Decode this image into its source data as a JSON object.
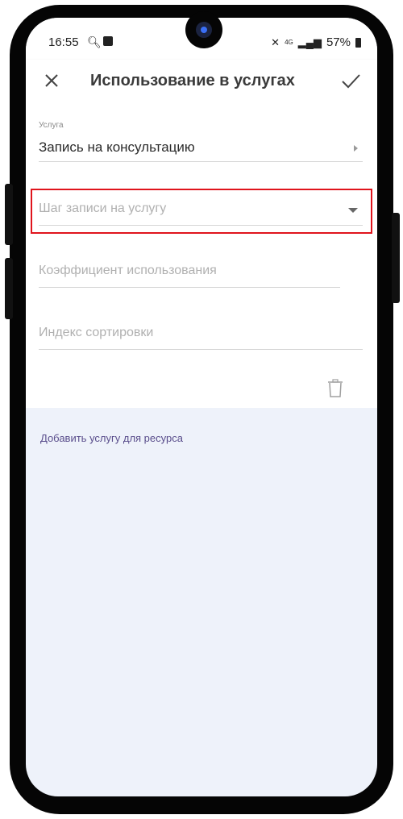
{
  "status_bar": {
    "time": "16:55",
    "battery": "57%",
    "network": "4G"
  },
  "header": {
    "title": "Использование в услугах",
    "close_icon": "close-icon",
    "confirm_icon": "check-icon"
  },
  "form": {
    "service": {
      "label": "Услуга",
      "value": "Запись на консультацию"
    },
    "booking_step": {
      "placeholder": "Шаг записи на услугу"
    },
    "usage_coefficient": {
      "placeholder": "Коэффициент использования"
    },
    "sort_index": {
      "placeholder": "Индекс сортировки"
    }
  },
  "actions": {
    "add_service": "Добавить услугу для ресурса"
  },
  "colors": {
    "highlight": "#e0141c",
    "link": "#5a4e8c",
    "background": "#eef2fa"
  }
}
